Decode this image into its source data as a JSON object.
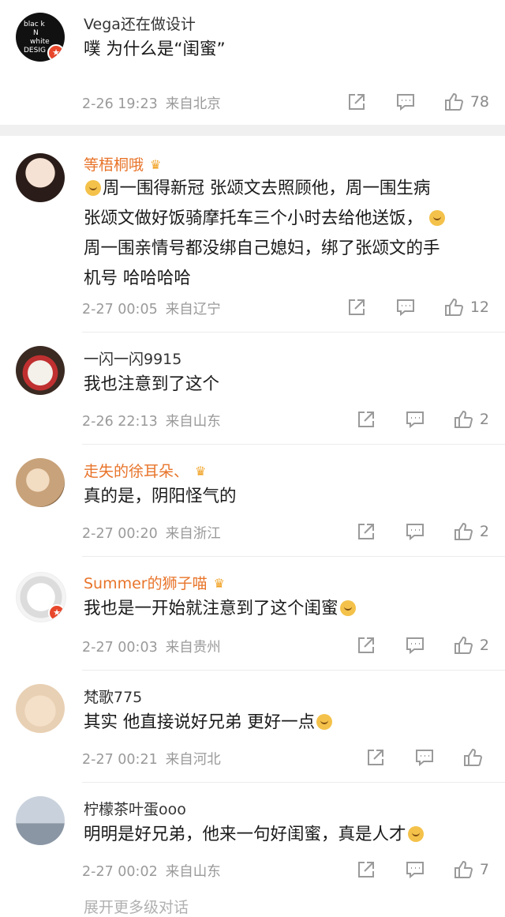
{
  "icons": {
    "share": "share-icon",
    "comment": "comment-icon",
    "like": "thumbs-up-icon",
    "crown": "crown-icon",
    "verified": "verified-badge-icon"
  },
  "colors": {
    "vip_name": "#e8742a",
    "verified": "#e8472c",
    "meta": "#9a9a9a"
  },
  "top_comment": {
    "username": "Vega还在做设计",
    "avatar_text": [
      "blac  k",
      "N",
      "white",
      "DESIG"
    ],
    "text": "噗 为什么是“闺蜜”",
    "date": "2-26 19:23",
    "location": "来自北京",
    "likes": "78"
  },
  "comments": [
    {
      "username": "等梧桐哦",
      "text_lines": [
        "周一围得新冠 张颂文去照顾他，周一围生病",
        "张颂文做好饭骑摩托车三个小时去给他送饭，",
        "周一围亲情号都没绑自己媳妇，绑了张颂文的手",
        "机号 哈哈哈哈"
      ],
      "date": "2-27 00:05",
      "location": "来自辽宁",
      "likes": "12"
    },
    {
      "username": "一闪一闪9915",
      "text": "我也注意到了这个",
      "date": "2-26 22:13",
      "location": "来自山东",
      "likes": "2"
    },
    {
      "username": "走失的徐耳朵、",
      "text": "真的是，阴阳怪气的",
      "date": "2-27 00:20",
      "location": "来自浙江",
      "likes": "2"
    },
    {
      "username": "Summer的狮子喵",
      "text": "我也是一开始就注意到了这个闺蜜",
      "date": "2-27 00:03",
      "location": "来自贵州",
      "likes": "2"
    },
    {
      "username": "梵歌775",
      "text": "其实 他直接说好兄弟 更好一点",
      "date": "2-27 00:21",
      "location": "来自河北",
      "likes": ""
    },
    {
      "username": "柠檬茶叶蛋ooo",
      "text": "明明是好兄弟，他来一句好闺蜜，真是人才",
      "date": "2-27 00:02",
      "location": "来自山东",
      "likes": "7"
    }
  ],
  "more_replies": "展开更多级对话"
}
